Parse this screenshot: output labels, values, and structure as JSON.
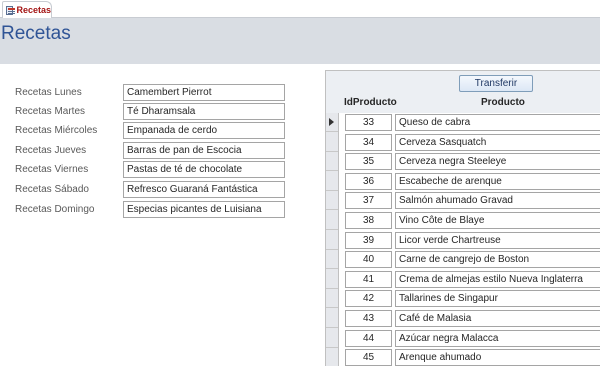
{
  "tab": {
    "label": "Recetas"
  },
  "header": {
    "title": "Recetas"
  },
  "weekdays": [
    {
      "label": "Recetas Lunes",
      "value": "Camembert Pierrot"
    },
    {
      "label": "Recetas Martes",
      "value": "Té Dharamsala"
    },
    {
      "label": "Recetas Miércoles",
      "value": "Empanada de cerdo"
    },
    {
      "label": "Recetas Jueves",
      "value": "Barras de pan de Escocia"
    },
    {
      "label": "Recetas Viernes",
      "value": "Pastas de té de chocolate"
    },
    {
      "label": "Recetas Sábado",
      "value": "Refresco Guaraná Fantástica"
    },
    {
      "label": "Recetas Domingo",
      "value": "Especias picantes de Luisiana"
    }
  ],
  "subform": {
    "transfer_label": "Transferir",
    "columns": {
      "id": "IdProducto",
      "product": "Producto"
    },
    "rows": [
      {
        "id": "33",
        "product": "Queso de cabra"
      },
      {
        "id": "34",
        "product": "Cerveza Sasquatch"
      },
      {
        "id": "35",
        "product": "Cerveza negra Steeleye"
      },
      {
        "id": "36",
        "product": "Escabeche de arenque"
      },
      {
        "id": "37",
        "product": "Salmón ahumado Gravad"
      },
      {
        "id": "38",
        "product": "Vino Côte de Blaye"
      },
      {
        "id": "39",
        "product": "Licor verde Chartreuse"
      },
      {
        "id": "40",
        "product": "Carne de cangrejo de Boston"
      },
      {
        "id": "41",
        "product": "Crema de almejas estilo Nueva Inglaterra"
      },
      {
        "id": "42",
        "product": "Tallarines de Singapur"
      },
      {
        "id": "43",
        "product": "Café de Malasia"
      },
      {
        "id": "44",
        "product": "Azúcar negra Malacca"
      },
      {
        "id": "45",
        "product": "Arenque ahumado"
      }
    ]
  },
  "colors": {
    "title": "#2f5496",
    "tab_label": "#a31515",
    "header_bg": "#d9dde3"
  }
}
